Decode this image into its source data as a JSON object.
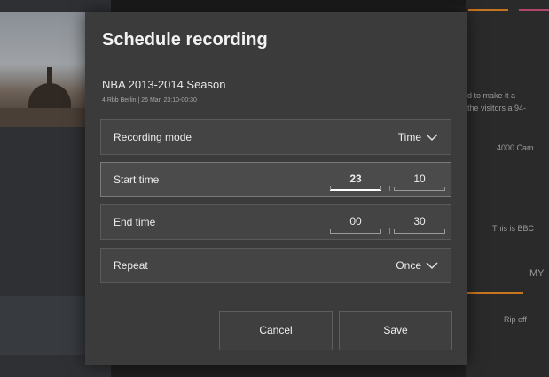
{
  "dialog": {
    "title": "Schedule recording",
    "program_title": "NBA 2013-2014 Season",
    "program_subtitle": "4 Rbb Berlin | 26 Mar. 23:10-00:30",
    "recording_mode": {
      "label": "Recording mode",
      "value": "Time"
    },
    "start_time": {
      "label": "Start time",
      "hours": "23",
      "minutes": "10"
    },
    "end_time": {
      "label": "End time",
      "hours": "00",
      "minutes": "30"
    },
    "repeat": {
      "label": "Repeat",
      "value": "Once"
    },
    "cancel_label": "Cancel",
    "save_label": "Save"
  },
  "background": {
    "right_text_1": "d to make it a",
    "right_text_2": "the visitors a 94-",
    "right_text_3": "4000 Cam",
    "right_text_4": "This is BBC",
    "right_text_5": "Rip off",
    "right_text_6": "MY"
  },
  "colors": {
    "accent_orange": "#c8751f",
    "accent_pink": "#b2476b",
    "dialog_bg": "#3b3b3b"
  },
  "icons": {
    "dropdown": "chevron-down-icon"
  }
}
